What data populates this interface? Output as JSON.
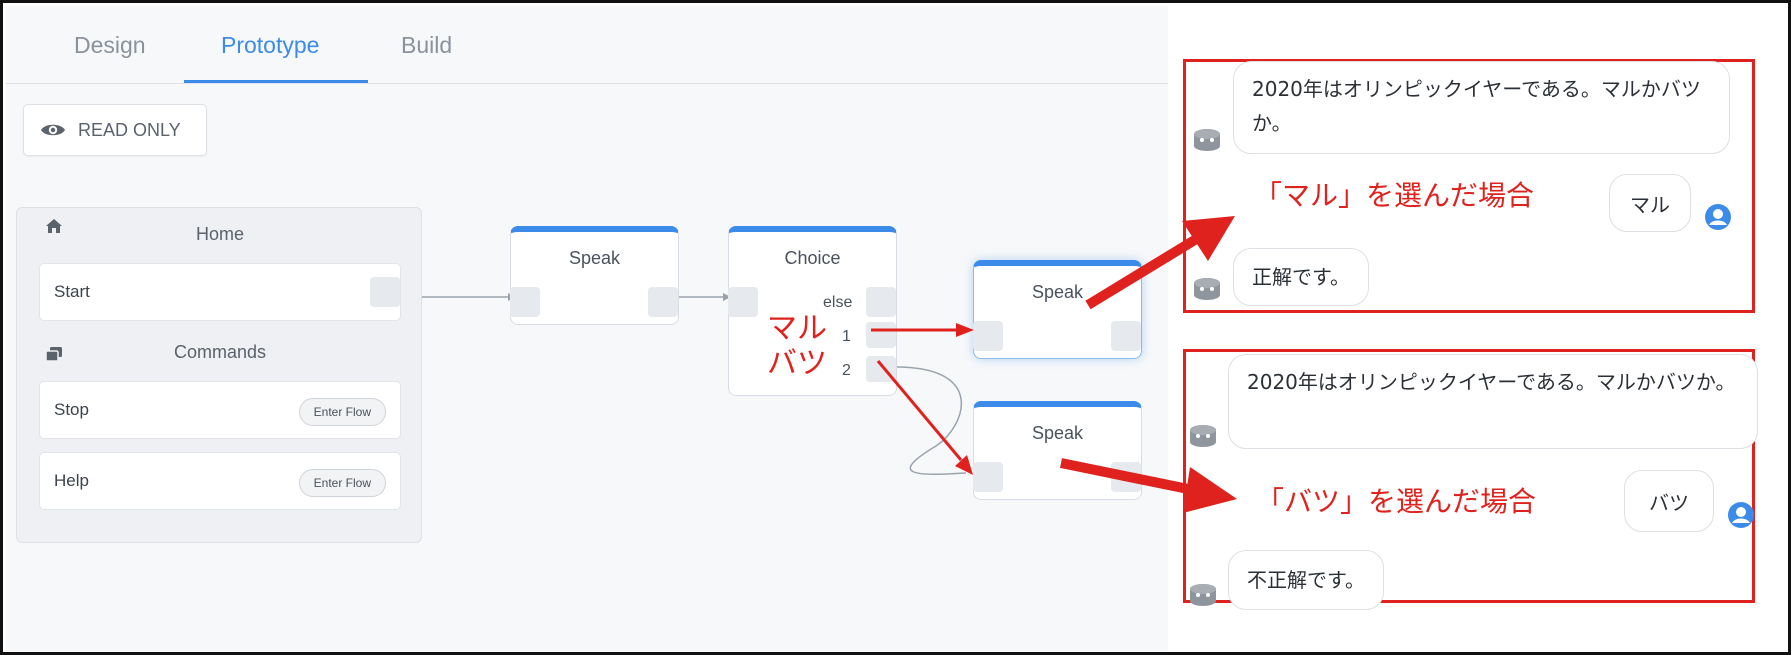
{
  "tabs": [
    {
      "label": "Design"
    },
    {
      "label": "Prototype"
    },
    {
      "label": "Build"
    }
  ],
  "toolbar": {
    "read_only_label": "READ ONLY"
  },
  "sidebar": {
    "home_label": "Home",
    "start_label": "Start",
    "commands_label": "Commands",
    "commands": [
      {
        "label": "Stop",
        "button": "Enter Flow"
      },
      {
        "label": "Help",
        "button": "Enter Flow"
      }
    ]
  },
  "nodes": {
    "speak_1": "Speak",
    "choice": "Choice",
    "choice_options": [
      "else",
      "1",
      "2"
    ],
    "speak_2": "Speak",
    "speak_3": "Speak"
  },
  "annotations": {
    "maru": "マル",
    "batsu": "バツ"
  },
  "chats": [
    {
      "question": "2020年はオリンピックイヤーである。マルかバツか。",
      "case_label": "「マル」を選んだ場合",
      "user_answer": "マル",
      "result": "正解です。"
    },
    {
      "question": "2020年はオリンピックイヤーである。マルかバツか。",
      "case_label": "「バツ」を選んだ場合",
      "user_answer": "バツ",
      "result": "不正解です。"
    }
  ],
  "colors": {
    "accent": "#3d8be8",
    "annotation_red": "#e0221e"
  },
  "icons": [
    "eye-icon",
    "home-icon",
    "commands-icon",
    "bot-avatar-icon",
    "user-avatar-icon"
  ]
}
